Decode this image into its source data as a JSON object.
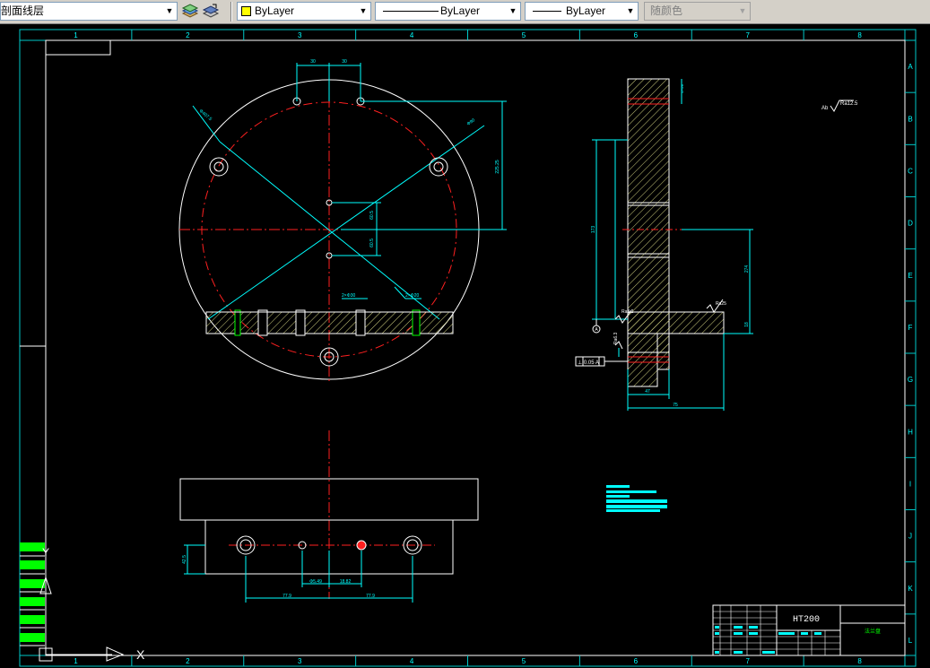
{
  "toolbar": {
    "layer_label": "剖面线层",
    "color_label": "ByLayer",
    "linetype_label": "ByLayer",
    "lineweight_label": "ByLayer",
    "plotstyle_label": "随颜色"
  },
  "drawing": {
    "grid_columns": [
      "1",
      "2",
      "3",
      "4",
      "5",
      "6",
      "7",
      "8"
    ],
    "grid_rows": [
      "A",
      "B",
      "C",
      "D",
      "E",
      "F",
      "G",
      "H",
      "I",
      "J",
      "K",
      "L"
    ],
    "dims": {
      "top_left_30": "30",
      "top_right_30": "30",
      "right_vertical": "225.25",
      "center_upper": "60.5",
      "center_lower": "60.5",
      "hole_left": "2×Φ30",
      "hole_right": "2×Φ20",
      "diag_left": "Φ407.5",
      "diag_right": "Φ90",
      "side_small": "4×Φ8",
      "side_173": "173",
      "side_274": "274",
      "side_18": "18",
      "side_47": "47",
      "side_75": "75",
      "bottom_left_779": "77.9",
      "bottom_center_left": "Φ5.49",
      "bottom_center_right": "18.82",
      "bottom_right_779": "77.9",
      "bottom_height": "42.5"
    },
    "roughness": {
      "top_right": "Ra12.5",
      "top_right_prefix": "Ab",
      "side_a": "Ra25",
      "side_b": "Ra3.2",
      "side_c": "Ra6.3"
    },
    "datum_label": "A",
    "tolerance_box": "⊥ 0.05 A",
    "title_block": {
      "material": "HT200",
      "name": "法兰盘",
      "scale_label": "比例",
      "qty_label": "数量"
    },
    "ucs": {
      "x_label": "X",
      "y_label": "Y"
    }
  }
}
